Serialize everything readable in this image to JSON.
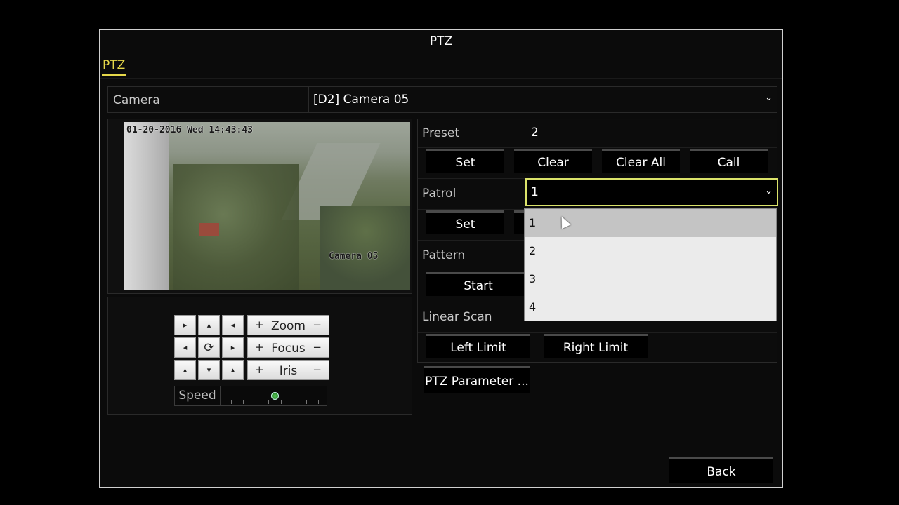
{
  "window": {
    "title": "PTZ"
  },
  "tabs": [
    {
      "label": "PTZ",
      "active": true
    }
  ],
  "camera": {
    "label": "Camera",
    "value": "[D2] Camera 05"
  },
  "video": {
    "osd_time": "01-20-2016 Wed 14:43:43",
    "osd_name": "Camera 05"
  },
  "lens": {
    "zoom": "Zoom",
    "focus": "Focus",
    "iris": "Iris",
    "plus": "+",
    "minus": "−"
  },
  "speed": {
    "label": "Speed",
    "level_fraction": 0.5
  },
  "preset": {
    "label": "Preset",
    "value": "2",
    "buttons": [
      "Set",
      "Clear",
      "Clear All",
      "Call"
    ]
  },
  "patrol": {
    "label": "Patrol",
    "value": "1",
    "set_label": "Set",
    "options": [
      "1",
      "2",
      "3",
      "4"
    ],
    "highlighted": "1"
  },
  "pattern": {
    "label": "Pattern",
    "start_label": "Start"
  },
  "linear_scan": {
    "label": "Linear Scan",
    "left_limit": "Left Limit",
    "right_limit": "Right Limit"
  },
  "param_button": "PTZ Parameter ...",
  "back_button": "Back",
  "colors": {
    "accent": "#e6d84a",
    "focus_border": "#dbe36a"
  }
}
